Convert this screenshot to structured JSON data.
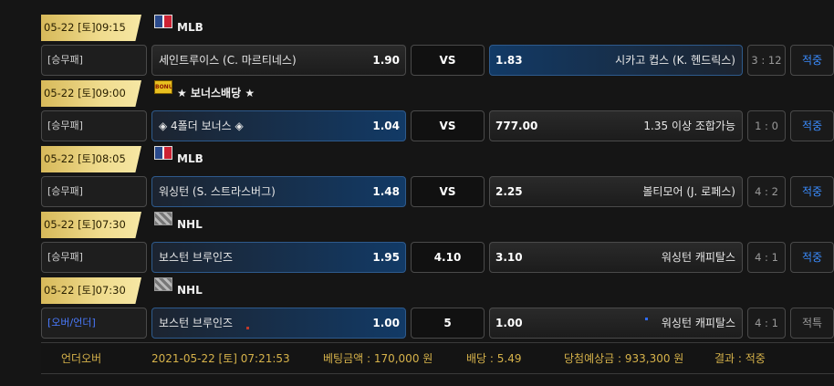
{
  "games": [
    {
      "date": "05-22 [토]09:15",
      "league_icon": "mlb-logo-icon",
      "league": "MLB",
      "bet_type": "[승무패]",
      "home": {
        "name": "세인트루이스 (C. 마르티네스)",
        "odds": "1.90",
        "selected": false
      },
      "middle": "VS",
      "away": {
        "name": "시카고 컵스 (K. 헨드릭스)",
        "odds": "1.83",
        "selected": true
      },
      "score": "3 : 12",
      "result": "적중"
    },
    {
      "date": "05-22 [토]09:00",
      "league_icon": "bonus-icon",
      "bonus_icon_text": "BONUS",
      "league": "★ 보너스배당 ★",
      "bet_type": "[승무패]",
      "home": {
        "name": "◈ 4폴더 보너스 ◈",
        "odds": "1.04",
        "selected": true
      },
      "middle": "VS",
      "away": {
        "name": "1.35 이상 조합가능",
        "odds": "777.00",
        "selected": false
      },
      "score": "1 : 0",
      "result": "적중"
    },
    {
      "date": "05-22 [토]08:05",
      "league_icon": "mlb-logo-icon",
      "league": "MLB",
      "bet_type": "[승무패]",
      "home": {
        "name": "워싱턴 (S. 스트라스버그)",
        "odds": "1.48",
        "selected": true
      },
      "middle": "VS",
      "away": {
        "name": "볼티모어 (J. 로페스)",
        "odds": "2.25",
        "selected": false
      },
      "score": "4 : 2",
      "result": "적중"
    },
    {
      "date": "05-22 [토]07:30",
      "league_icon": "nhl-logo-icon",
      "league": "NHL",
      "bet_type": "[승무패]",
      "home": {
        "name": "보스턴 브루인즈",
        "odds": "1.95",
        "selected": true
      },
      "middle": "4.10",
      "away": {
        "name": "워싱턴 캐피탈스",
        "odds": "3.10",
        "selected": false
      },
      "score": "4 : 1",
      "result": "적중"
    },
    {
      "date": "05-22 [토]07:30",
      "league_icon": "nhl-logo-icon",
      "league": "NHL",
      "bet_type": "[오버/언더]",
      "home": {
        "name": "보스턴 브루인즈",
        "odds": "1.00",
        "selected": true
      },
      "middle": "5",
      "away": {
        "name": "워싱턴 캐피탈스",
        "odds": "1.00",
        "selected": false
      },
      "score": "4 : 1",
      "result": "적특"
    }
  ],
  "footer": {
    "type": "언더오버",
    "datetime": "2021-05-22 [토] 07:21:53",
    "bet_amount": "베팅금액 : 170,000 원",
    "odds": "배당 : 5.49",
    "expected_win": "당첨예상금 : 933,300 원",
    "result": "결과 : 적중"
  },
  "colors": {
    "gold_tag": "#e6cb70",
    "selected_blue": "#123a66",
    "hit_text": "#3a8cff",
    "footer_text": "#d6b24a"
  }
}
